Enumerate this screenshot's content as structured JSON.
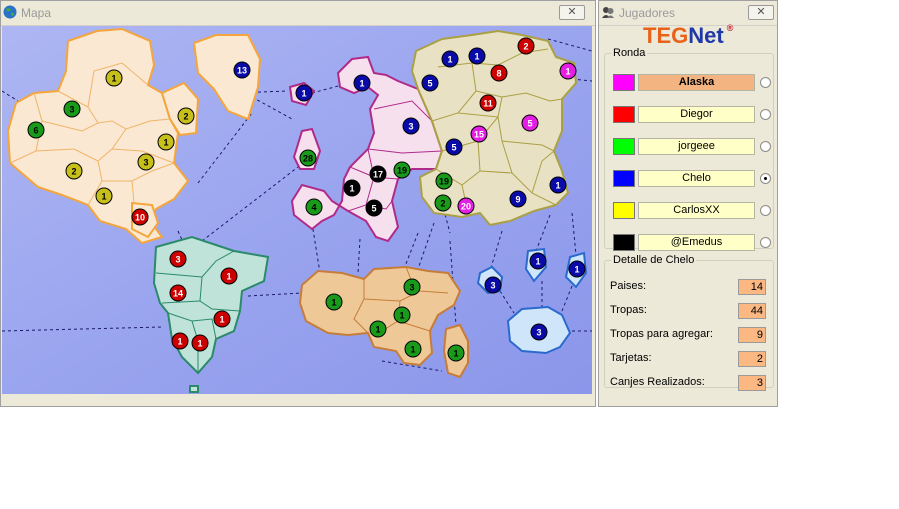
{
  "map_window": {
    "title": "Mapa",
    "close_label": "✕"
  },
  "players_window": {
    "title": "Jugadores",
    "close_label": "✕",
    "logo_teg": "TEG",
    "logo_net": "Net",
    "logo_reg": "®"
  },
  "round": {
    "legend": "Ronda",
    "players": [
      {
        "name": "Alaska",
        "color": "#ff00ff",
        "active": true,
        "selected": false
      },
      {
        "name": "Diegor",
        "color": "#ff0000",
        "active": false,
        "selected": false
      },
      {
        "name": "jorgeee",
        "color": "#00ff00",
        "active": false,
        "selected": false
      },
      {
        "name": "Chelo",
        "color": "#0000ff",
        "active": false,
        "selected": true
      },
      {
        "name": "CarlosXX",
        "color": "#ffff00",
        "active": false,
        "selected": false
      },
      {
        "name": "@Emedus",
        "color": "#000000",
        "active": false,
        "selected": false
      }
    ]
  },
  "details": {
    "legend": "Detalle de Chelo",
    "rows": [
      {
        "label": "Paises:",
        "value": "14"
      },
      {
        "label": "Tropas:",
        "value": "44"
      },
      {
        "label": "Tropas para agregar:",
        "value": "9"
      },
      {
        "label": "Tarjetas:",
        "value": "2"
      },
      {
        "label": "Canjes Realizados:",
        "value": "3"
      }
    ]
  },
  "player_colors": {
    "magenta": "#e41ee4",
    "red": "#cc0000",
    "green": "#1a9a1a",
    "blue": "#0a0aa8",
    "yellow": "#c8c01a",
    "black": "#000000"
  },
  "army_counts": {
    "n_america": [
      "1",
      "3",
      "6",
      "2",
      "1",
      "3",
      "2",
      "1",
      "10",
      "13"
    ],
    "s_america": [
      "3",
      "1",
      "14",
      "1",
      "1",
      "1"
    ],
    "europe": [
      "1",
      "1",
      "28",
      "3",
      "19",
      "1",
      "17",
      "4",
      "5"
    ],
    "asia": [
      "1",
      "1",
      "5",
      "5",
      "1",
      "2",
      "8",
      "11",
      "15",
      "5",
      "19",
      "2",
      "20",
      "9",
      "1"
    ],
    "africa": [
      "1",
      "3",
      "1",
      "1",
      "1",
      "1"
    ],
    "oceania": [
      "3",
      "1",
      "1",
      "3"
    ]
  }
}
